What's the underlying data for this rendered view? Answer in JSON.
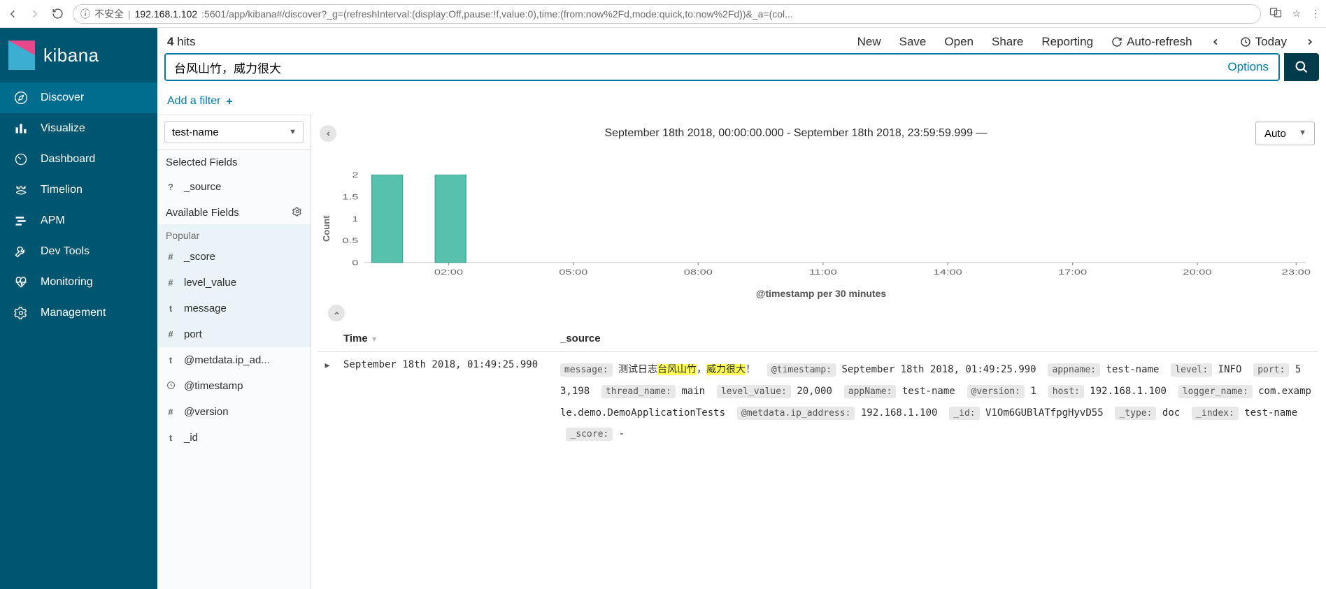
{
  "browser": {
    "insecure_label": "不安全",
    "url_host": "192.168.1.102",
    "url_port": ":5601",
    "url_path": "/app/kibana#/discover?_g=(refreshInterval:(display:Off,pause:!f,value:0),time:(from:now%2Fd,mode:quick,to:now%2Fd))&_a=(col..."
  },
  "brand": {
    "name": "kibana"
  },
  "nav": {
    "discover": "Discover",
    "visualize": "Visualize",
    "dashboard": "Dashboard",
    "timelion": "Timelion",
    "apm": "APM",
    "devtools": "Dev Tools",
    "monitoring": "Monitoring",
    "management": "Management"
  },
  "topbar": {
    "hits_count": "4",
    "hits_label": "hits",
    "new": "New",
    "save": "Save",
    "open": "Open",
    "share": "Share",
    "reporting": "Reporting",
    "autorefresh": "Auto-refresh",
    "today": "Today"
  },
  "search": {
    "value": "台风山竹，威力很大",
    "options": "Options"
  },
  "filter": {
    "add": "Add a filter"
  },
  "fields": {
    "index_pattern": "test-name",
    "selected_label": "Selected Fields",
    "selected_source": "_source",
    "available_label": "Available Fields",
    "popular_label": "Popular",
    "score": "_score",
    "level_value": "level_value",
    "message": "message",
    "port": "port",
    "metdata_ip": "@metdata.ip_ad...",
    "timestamp": "@timestamp",
    "version": "@version",
    "id": "_id"
  },
  "chart": {
    "time_range": "September 18th 2018, 00:00:00.000 - September 18th 2018, 23:59:59.999 —",
    "interval": "Auto",
    "ylabel": "Count",
    "xlabel": "@timestamp per 30 minutes"
  },
  "chart_data": {
    "type": "bar",
    "title": "",
    "xlabel": "@timestamp per 30 minutes",
    "ylabel": "Count",
    "ylim": [
      0,
      2
    ],
    "yticks": [
      0,
      0.5,
      1,
      1.5,
      2
    ],
    "x_tick_labels": [
      "02:00",
      "05:00",
      "08:00",
      "11:00",
      "14:00",
      "17:00",
      "20:00",
      "23:00"
    ],
    "bars": [
      {
        "bucket": "01:30",
        "value": 2
      },
      {
        "bucket": "02:30",
        "value": 2
      }
    ]
  },
  "table": {
    "col_time": "Time",
    "col_source": "_source",
    "row0": {
      "time": "September 18th 2018, 01:49:25.990",
      "k_message": "message:",
      "v_message_pre": "测试日志",
      "v_message_hl1": "台风山竹",
      "v_message_mid": "，",
      "v_message_hl2": "威力很大",
      "v_message_post": "！",
      "k_timestamp": "@timestamp:",
      "v_timestamp": "September 18th 2018, 01:49:25.990",
      "k_appname": "appname:",
      "v_appname": "test-name",
      "k_level": "level:",
      "v_level": "INFO",
      "k_port": "port:",
      "v_port": "53,198",
      "k_thread": "thread_name:",
      "v_thread": "main",
      "k_levelval": "level_value:",
      "v_levelval": "20,000",
      "k_appName2": "appName:",
      "v_appName2": "test-name",
      "k_version": "@version:",
      "v_version": "1",
      "k_host": "host:",
      "v_host": "192.168.1.100",
      "k_logger": "logger_name:",
      "v_logger": "com.example.demo.DemoApplicationTests",
      "k_ip": "@metdata.ip_address:",
      "v_ip": "192.168.1.100",
      "k_id": "_id:",
      "v_id": "V1Om6GUBlATfpgHyvD55",
      "k_type": "_type:",
      "v_type": "doc",
      "k_index": "_index:",
      "v_index": "test-name",
      "k_score": "_score:",
      "v_score": "-"
    }
  }
}
